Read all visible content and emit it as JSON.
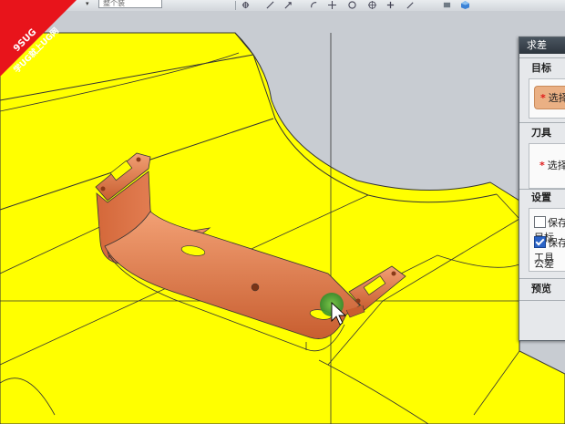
{
  "toolbar": {
    "combo_value": "整个装",
    "icons": [
      "snap-icon",
      "line-icon",
      "arrow-icon",
      "arc-icon",
      "cross-icon",
      "circle-icon",
      "target-icon",
      "plus-icon",
      "arrow2-icon",
      "cube-icon"
    ]
  },
  "badge": {
    "line1": "9SUG",
    "line2": "学UG就上UG网",
    "color": "#e8141b"
  },
  "dialog": {
    "title": "求差",
    "target_section": "目标",
    "target_select": "选择",
    "tool_section": "刀具",
    "tool_select": "选择",
    "settings_section": "设置",
    "keep_target_label": "保存目标",
    "keep_target_checked": false,
    "keep_tool_label": "保存工具",
    "keep_tool_checked": true,
    "tolerance_label": "公差",
    "preview_section": "预览"
  },
  "colors": {
    "mold_yellow": "#ffff00",
    "part_orange": "#e07a4a",
    "background_gray": "#c8ccd2",
    "highlight_green": "#3aa83a"
  }
}
